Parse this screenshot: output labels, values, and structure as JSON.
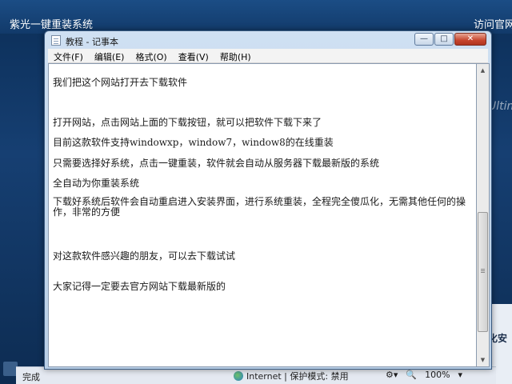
{
  "background_app": {
    "title": "紫光一键重装系统",
    "link": "访问官网",
    "side_text": "Ultim",
    "side_text2": "化安"
  },
  "ie_statusbar": {
    "status": "完成",
    "zone": "Internet | 保护模式: 禁用",
    "zoom": "100%"
  },
  "notepad": {
    "title": "教程 - 记事本",
    "buttons": {
      "minimize": "—",
      "maximize": "□",
      "close": "✕"
    },
    "menu": [
      "文件(F)",
      "编辑(E)",
      "格式(O)",
      "查看(V)",
      "帮助(H)"
    ],
    "lines": [
      "我们把这个网站打开去下载软件",
      "打开网站，点击网站上面的下载按钮，就可以把软件下载下来了",
      "目前这款软件支持windowxp，window7，window8的在线重装",
      "只需要选择好系统，点击一键重装，软件就会自动从服务器下载最新版的系统",
      "全自动为你重装系统",
      "下载好系统后软件会自动重启进入安装界面，进行系统重装，全程完全傻瓜化，无需其他任何的操作，非常的方便",
      "对这款软件感兴趣的朋友，可以去下载试试",
      "大家记得一定要去官方网站下载最新版的"
    ]
  }
}
